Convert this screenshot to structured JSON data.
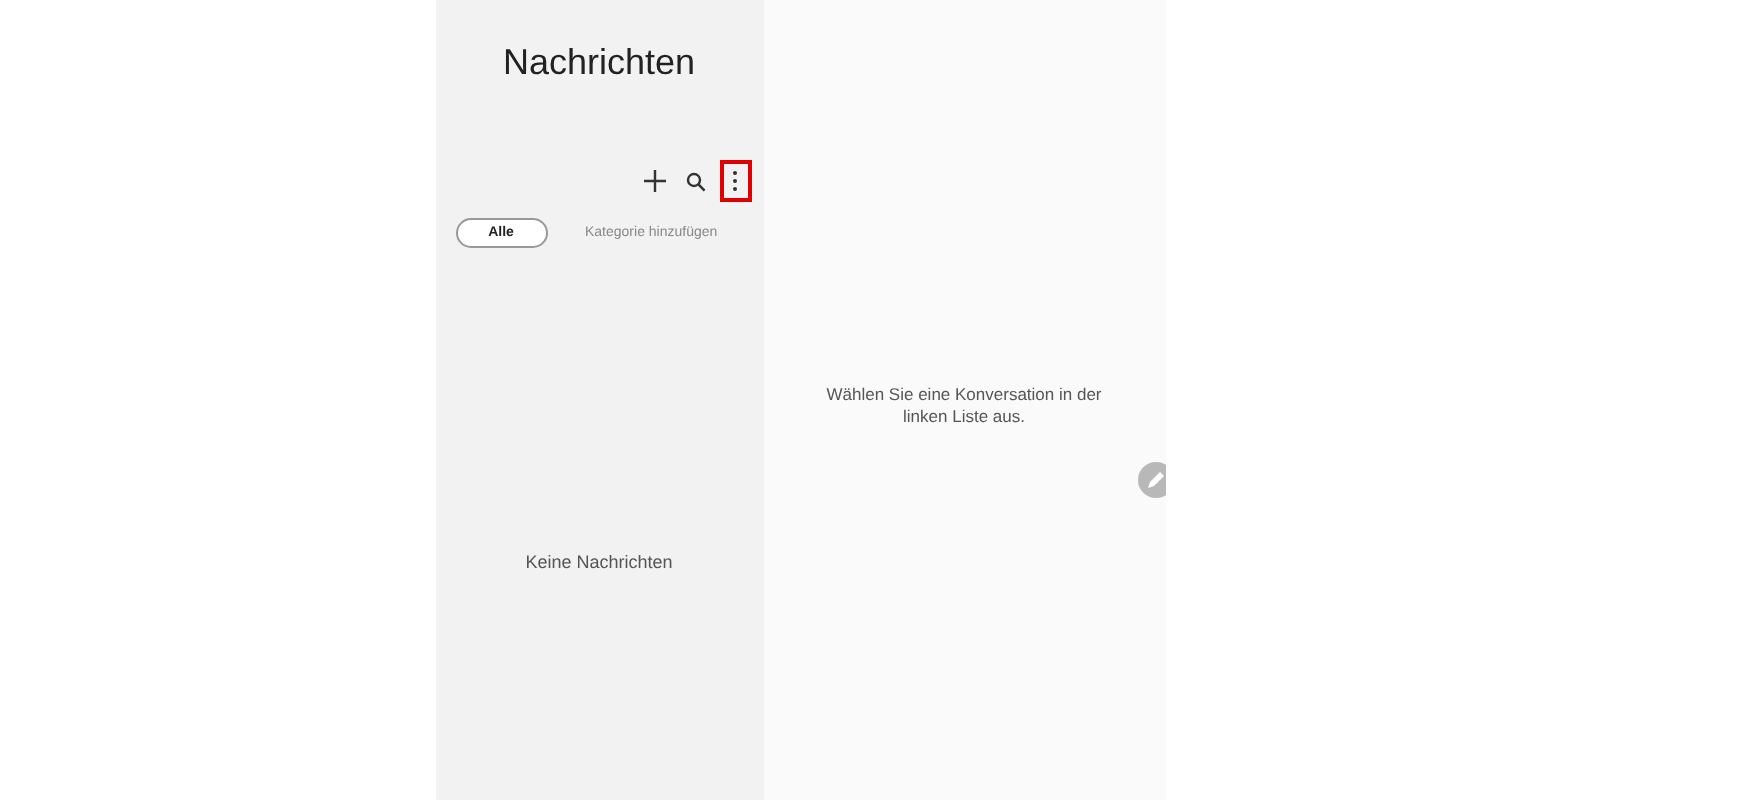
{
  "list_panel": {
    "title": "Nachrichten",
    "toolbar": [
      {
        "kind": "add",
        "highlighted": false
      },
      {
        "kind": "search",
        "highlighted": false
      },
      {
        "kind": "more",
        "highlighted": true
      }
    ],
    "tabs": [
      {
        "label": "Alle",
        "selected": true
      },
      {
        "label": "Kategorie hinzufügen",
        "selected": false
      }
    ],
    "empty_text": "Keine Nachrichten"
  },
  "detail_panel": {
    "hint": "Wählen Sie eine Konversation in der linken Liste aus."
  }
}
